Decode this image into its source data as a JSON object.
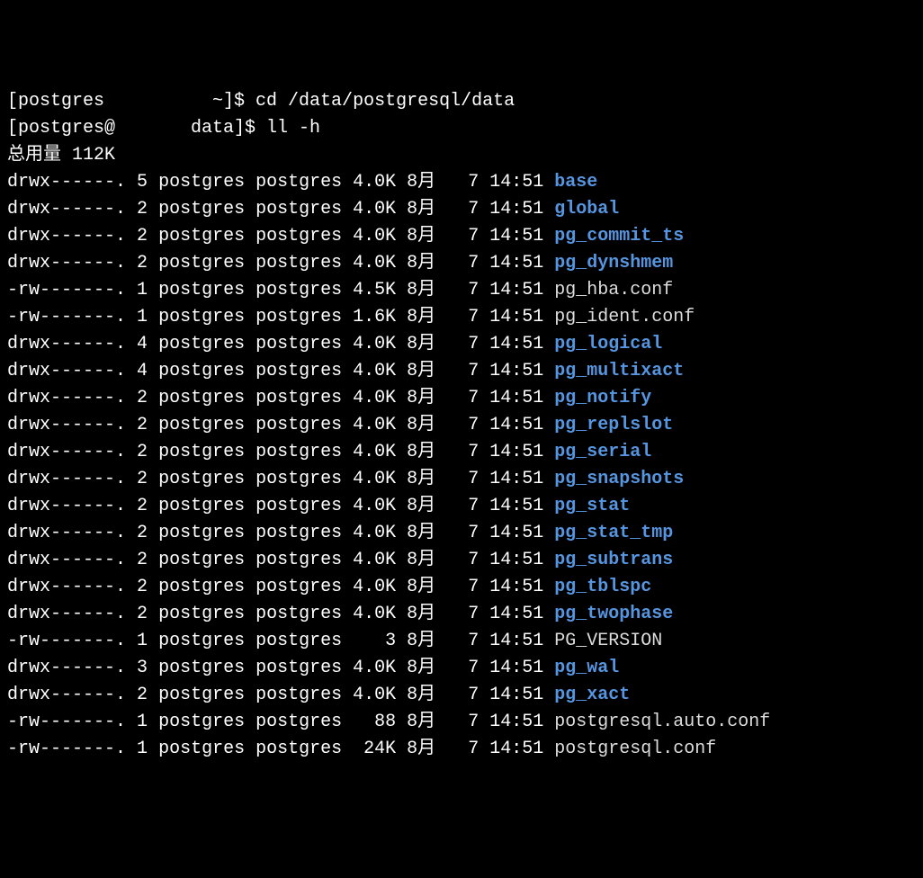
{
  "prompt1": {
    "open": "[postgres",
    "mid": "~]$ ",
    "cmd": "cd /data/postgresql/data"
  },
  "prompt2": {
    "open": "[postgres@",
    "mid": "data]$ ",
    "cmd": "ll -h"
  },
  "total_label": "总用量 112K",
  "entries": [
    {
      "perm": "drwx------.",
      "links": "5",
      "owner": "postgres",
      "group": "postgres",
      "size": "4.0K",
      "month": "8月",
      "day": "7",
      "time": "14:51",
      "name": "base",
      "type": "dir"
    },
    {
      "perm": "drwx------.",
      "links": "2",
      "owner": "postgres",
      "group": "postgres",
      "size": "4.0K",
      "month": "8月",
      "day": "7",
      "time": "14:51",
      "name": "global",
      "type": "dir"
    },
    {
      "perm": "drwx------.",
      "links": "2",
      "owner": "postgres",
      "group": "postgres",
      "size": "4.0K",
      "month": "8月",
      "day": "7",
      "time": "14:51",
      "name": "pg_commit_ts",
      "type": "dir"
    },
    {
      "perm": "drwx------.",
      "links": "2",
      "owner": "postgres",
      "group": "postgres",
      "size": "4.0K",
      "month": "8月",
      "day": "7",
      "time": "14:51",
      "name": "pg_dynshmem",
      "type": "dir"
    },
    {
      "perm": "-rw-------.",
      "links": "1",
      "owner": "postgres",
      "group": "postgres",
      "size": "4.5K",
      "month": "8月",
      "day": "7",
      "time": "14:51",
      "name": "pg_hba.conf",
      "type": "file"
    },
    {
      "perm": "-rw-------.",
      "links": "1",
      "owner": "postgres",
      "group": "postgres",
      "size": "1.6K",
      "month": "8月",
      "day": "7",
      "time": "14:51",
      "name": "pg_ident.conf",
      "type": "file"
    },
    {
      "perm": "drwx------.",
      "links": "4",
      "owner": "postgres",
      "group": "postgres",
      "size": "4.0K",
      "month": "8月",
      "day": "7",
      "time": "14:51",
      "name": "pg_logical",
      "type": "dir"
    },
    {
      "perm": "drwx------.",
      "links": "4",
      "owner": "postgres",
      "group": "postgres",
      "size": "4.0K",
      "month": "8月",
      "day": "7",
      "time": "14:51",
      "name": "pg_multixact",
      "type": "dir"
    },
    {
      "perm": "drwx------.",
      "links": "2",
      "owner": "postgres",
      "group": "postgres",
      "size": "4.0K",
      "month": "8月",
      "day": "7",
      "time": "14:51",
      "name": "pg_notify",
      "type": "dir"
    },
    {
      "perm": "drwx------.",
      "links": "2",
      "owner": "postgres",
      "group": "postgres",
      "size": "4.0K",
      "month": "8月",
      "day": "7",
      "time": "14:51",
      "name": "pg_replslot",
      "type": "dir"
    },
    {
      "perm": "drwx------.",
      "links": "2",
      "owner": "postgres",
      "group": "postgres",
      "size": "4.0K",
      "month": "8月",
      "day": "7",
      "time": "14:51",
      "name": "pg_serial",
      "type": "dir"
    },
    {
      "perm": "drwx------.",
      "links": "2",
      "owner": "postgres",
      "group": "postgres",
      "size": "4.0K",
      "month": "8月",
      "day": "7",
      "time": "14:51",
      "name": "pg_snapshots",
      "type": "dir"
    },
    {
      "perm": "drwx------.",
      "links": "2",
      "owner": "postgres",
      "group": "postgres",
      "size": "4.0K",
      "month": "8月",
      "day": "7",
      "time": "14:51",
      "name": "pg_stat",
      "type": "dir"
    },
    {
      "perm": "drwx------.",
      "links": "2",
      "owner": "postgres",
      "group": "postgres",
      "size": "4.0K",
      "month": "8月",
      "day": "7",
      "time": "14:51",
      "name": "pg_stat_tmp",
      "type": "dir"
    },
    {
      "perm": "drwx------.",
      "links": "2",
      "owner": "postgres",
      "group": "postgres",
      "size": "4.0K",
      "month": "8月",
      "day": "7",
      "time": "14:51",
      "name": "pg_subtrans",
      "type": "dir"
    },
    {
      "perm": "drwx------.",
      "links": "2",
      "owner": "postgres",
      "group": "postgres",
      "size": "4.0K",
      "month": "8月",
      "day": "7",
      "time": "14:51",
      "name": "pg_tblspc",
      "type": "dir"
    },
    {
      "perm": "drwx------.",
      "links": "2",
      "owner": "postgres",
      "group": "postgres",
      "size": "4.0K",
      "month": "8月",
      "day": "7",
      "time": "14:51",
      "name": "pg_twophase",
      "type": "dir"
    },
    {
      "perm": "-rw-------.",
      "links": "1",
      "owner": "postgres",
      "group": "postgres",
      "size": "3",
      "month": "8月",
      "day": "7",
      "time": "14:51",
      "name": "PG_VERSION",
      "type": "file"
    },
    {
      "perm": "drwx------.",
      "links": "3",
      "owner": "postgres",
      "group": "postgres",
      "size": "4.0K",
      "month": "8月",
      "day": "7",
      "time": "14:51",
      "name": "pg_wal",
      "type": "dir"
    },
    {
      "perm": "drwx------.",
      "links": "2",
      "owner": "postgres",
      "group": "postgres",
      "size": "4.0K",
      "month": "8月",
      "day": "7",
      "time": "14:51",
      "name": "pg_xact",
      "type": "dir"
    },
    {
      "perm": "-rw-------.",
      "links": "1",
      "owner": "postgres",
      "group": "postgres",
      "size": "88",
      "month": "8月",
      "day": "7",
      "time": "14:51",
      "name": "postgresql.auto.conf",
      "type": "file"
    },
    {
      "perm": "-rw-------.",
      "links": "1",
      "owner": "postgres",
      "group": "postgres",
      "size": "24K",
      "month": "8月",
      "day": "7",
      "time": "14:51",
      "name": "postgresql.conf",
      "type": "file"
    }
  ]
}
